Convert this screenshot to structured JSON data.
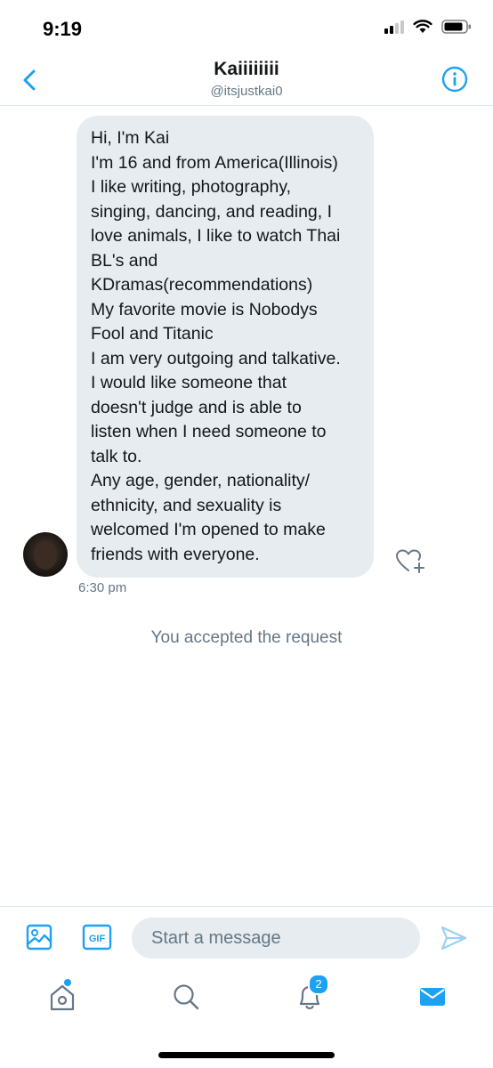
{
  "status_bar": {
    "time": "9:19"
  },
  "header": {
    "title": "Kaiiiiiiii",
    "handle": "@itsjustkai0"
  },
  "message": {
    "lines": [
      "Hi, I'm Kai",
      "I'm 16 and from America(Illinois)",
      "I like writing, photography,",
      "singing, dancing, and reading, I",
      "love animals, I like to watch Thai",
      "BL's and",
      "KDramas(recommendations)",
      "My favorite movie is Nobodys",
      "Fool and Titanic",
      "I am very outgoing and talkative.",
      "I would like someone that",
      "doesn't judge and is able to",
      "listen when I need someone to",
      "talk to.",
      "Any age, gender, nationality/",
      "ethnicity, and sexuality is",
      "welcomed I'm opened to make",
      "friends with everyone."
    ],
    "time": "6:30 pm"
  },
  "system_message": "You accepted the request",
  "composer": {
    "placeholder": "Start a message",
    "gif_label": "GIF"
  },
  "tabbar": {
    "notifications_count": "2"
  },
  "colors": {
    "accent": "#1da1f2",
    "bubble": "#e6ecf0",
    "muted": "#657786"
  },
  "icons": [
    "back-arrow-icon",
    "info-icon",
    "like-add-icon",
    "image-icon",
    "gif-icon",
    "send-icon",
    "home-icon",
    "search-icon",
    "bell-icon",
    "mail-icon"
  ]
}
